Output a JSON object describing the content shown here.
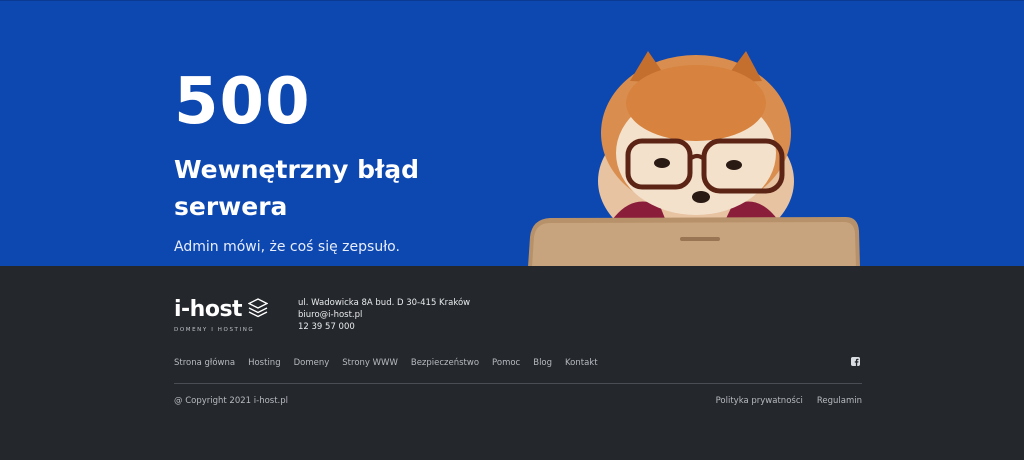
{
  "hero": {
    "code": "500",
    "title": "Wewnętrzny błąd serwera",
    "subtitle": "Admin mówi, że coś się zepsuło."
  },
  "footer": {
    "logo": {
      "name": "i-host",
      "tagline": "DOMENY I HOSTING",
      "icon": "stack-icon"
    },
    "contact": {
      "address": "ul. Wadowicka 8A bud. D 30-415 Kraków",
      "email": "biuro@i-host.pl",
      "phone": "12 39 57 000"
    },
    "nav": [
      "Strona główna",
      "Hosting",
      "Domeny",
      "Strony WWW",
      "Bezpieczeństwo",
      "Pomoc",
      "Blog",
      "Kontakt"
    ],
    "social_icon": "facebook-icon",
    "copyright": "@ Copyright 2021 i-host.pl",
    "legal": [
      "Polityka prywatności",
      "Regulamin"
    ]
  },
  "colors": {
    "hero_bg": "#0d47b0",
    "footer_bg": "#24272b",
    "text_primary": "#ffffff",
    "text_muted": "#b7bbc1"
  }
}
